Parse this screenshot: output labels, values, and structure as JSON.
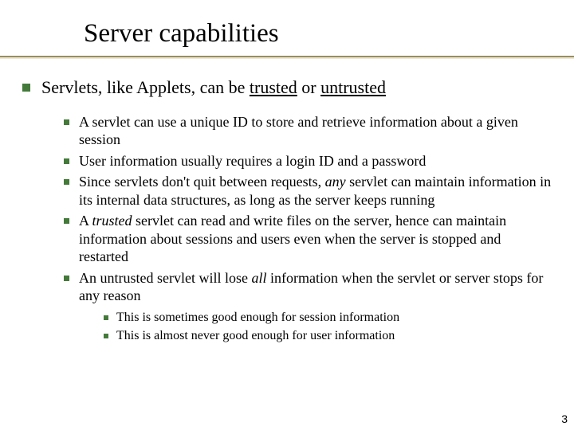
{
  "title": "Server capabilities",
  "main": {
    "pre": "Servlets, like Applets, can be ",
    "u1": "trusted",
    "mid": " or ",
    "u2": "untrusted"
  },
  "bullets": [
    {
      "text": "A servlet can use a unique ID to store and retrieve information about a given session"
    },
    {
      "text": "User information usually requires a login ID and a password"
    },
    {
      "pre": "Since servlets don't quit between requests, ",
      "i": "any",
      "post": " servlet can maintain information in its internal data structures, as long as the server keeps running"
    },
    {
      "pre": "A ",
      "i": "trusted",
      "post": " servlet can read and write files on the server, hence can maintain information about sessions and users even when the server is stopped and restarted"
    },
    {
      "pre": "An untrusted servlet will lose ",
      "i": "all",
      "post": " information when the servlet or server stops for any reason"
    }
  ],
  "sub": [
    {
      "text": "This is sometimes good enough for session information"
    },
    {
      "text": "This is almost never good enough for user information"
    }
  ],
  "page": "3",
  "colors": {
    "bullet": "#437a3a",
    "rule": "#8a7a3f"
  }
}
